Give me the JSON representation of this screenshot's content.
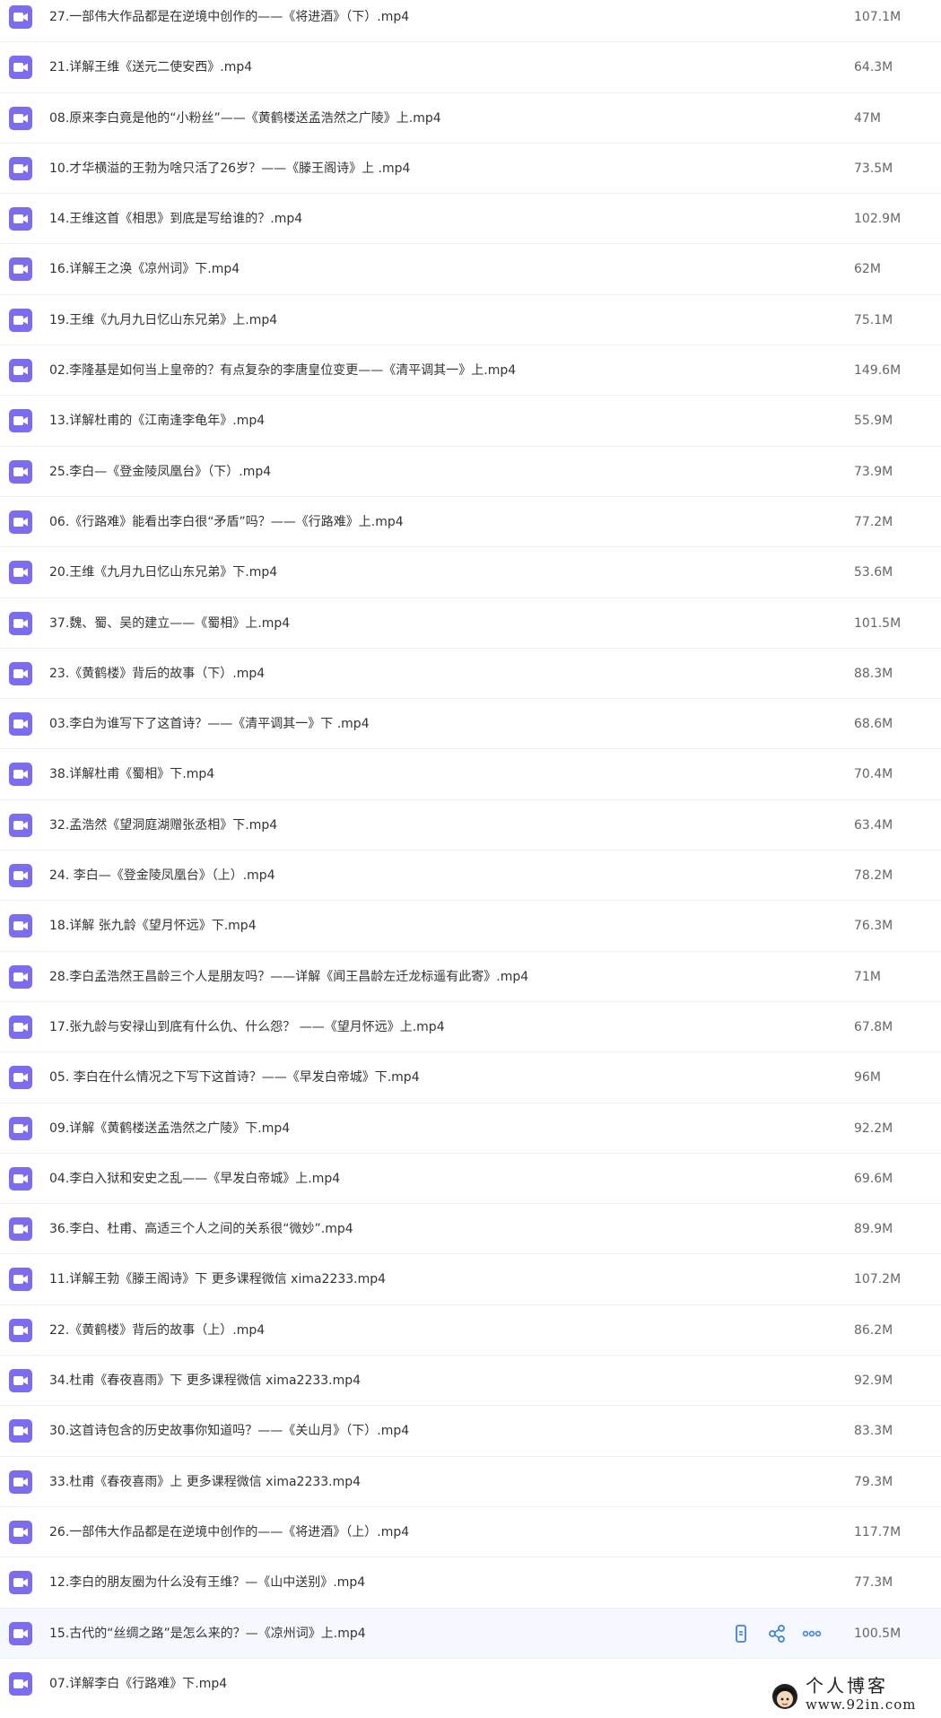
{
  "files": [
    {
      "name": "27.一部伟大作品都是在逆境中创作的——《将进酒》（下）.mp4",
      "size": "107.1M"
    },
    {
      "name": "21.详解王维《送元二使安西》.mp4",
      "size": "64.3M"
    },
    {
      "name": "08.原来李白竟是他的“小粉丝”——《黄鹤楼送孟浩然之广陵》上.mp4",
      "size": "47M"
    },
    {
      "name": "10.才华横溢的王勃为啥只活了26岁？——《滕王阁诗》上 .mp4",
      "size": "73.5M"
    },
    {
      "name": "14.王维这首《相思》到底是写给谁的？.mp4",
      "size": "102.9M"
    },
    {
      "name": "16.详解王之涣《凉州词》下.mp4",
      "size": "62M"
    },
    {
      "name": "19.王维《九月九日忆山东兄弟》上.mp4",
      "size": "75.1M"
    },
    {
      "name": "02.李隆基是如何当上皇帝的？有点复杂的李唐皇位变更——《清平调其一》上.mp4",
      "size": "149.6M"
    },
    {
      "name": "13.详解杜甫的《江南逢李龟年》.mp4",
      "size": "55.9M"
    },
    {
      "name": "25.李白—《登金陵凤凰台》（下）.mp4",
      "size": "73.9M"
    },
    {
      "name": "06.《行路难》能看出李白很“矛盾”吗？——《行路难》上.mp4",
      "size": "77.2M"
    },
    {
      "name": "20.王维《九月九日忆山东兄弟》下.mp4",
      "size": "53.6M"
    },
    {
      "name": "37.魏、蜀、吴的建立——《蜀相》上.mp4",
      "size": "101.5M"
    },
    {
      "name": "23.《黄鹤楼》背后的故事（下）.mp4",
      "size": "88.3M"
    },
    {
      "name": "03.李白为谁写下了这首诗？——《清平调其一》下 .mp4",
      "size": "68.6M"
    },
    {
      "name": "38.详解杜甫《蜀相》下.mp4",
      "size": "70.4M"
    },
    {
      "name": "32.孟浩然《望洞庭湖赠张丞相》下.mp4",
      "size": "63.4M"
    },
    {
      "name": "24. 李白—《登金陵凤凰台》（上）.mp4",
      "size": "78.2M"
    },
    {
      "name": "18.详解 张九龄《望月怀远》下.mp4",
      "size": "76.3M"
    },
    {
      "name": "28.李白孟浩然王昌龄三个人是朋友吗？——详解《闻王昌龄左迁龙标遥有此寄》.mp4",
      "size": "71M"
    },
    {
      "name": "17.张九龄与安禄山到底有什么仇、什么怨？ ——《望月怀远》上.mp4",
      "size": "67.8M"
    },
    {
      "name": "05. 李白在什么情况之下写下这首诗？——《早发白帝城》下.mp4",
      "size": "96M"
    },
    {
      "name": "09.详解《黄鹤楼送孟浩然之广陵》下.mp4",
      "size": "92.2M"
    },
    {
      "name": "04.李白入狱和安史之乱——《早发白帝城》上.mp4",
      "size": "69.6M"
    },
    {
      "name": "36.李白、杜甫、高适三个人之间的关系很“微妙”.mp4",
      "size": "89.9M"
    },
    {
      "name": "11.详解王勃《滕王阁诗》下 更多课程微信 xima2233.mp4",
      "size": "107.2M"
    },
    {
      "name": "22.《黄鹤楼》背后的故事（上）.mp4",
      "size": "86.2M"
    },
    {
      "name": "34.杜甫《春夜喜雨》下 更多课程微信 xima2233.mp4",
      "size": "92.9M"
    },
    {
      "name": "30.这首诗包含的历史故事你知道吗？——《关山月》（下）.mp4",
      "size": "83.3M"
    },
    {
      "name": "33.杜甫《春夜喜雨》上 更多课程微信 xima2233.mp4",
      "size": "79.3M"
    },
    {
      "name": "26.一部伟大作品都是在逆境中创作的——《将进酒》（上）.mp4",
      "size": "117.7M"
    },
    {
      "name": "12.李白的朋友圈为什么没有王维？—《山中送别》.mp4",
      "size": "77.3M"
    },
    {
      "name": "15.古代的“丝绸之路”是怎么来的？—《凉州词》上.mp4",
      "size": "100.5M",
      "hover": true
    },
    {
      "name": "07.详解李白《行路难》下.mp4",
      "size": ""
    }
  ],
  "watermark": {
    "name": "个人博客",
    "url": "www.92in.com"
  },
  "colors": {
    "file_icon": "#7c6cf3",
    "action_icon": "#3b82f6",
    "hover_row": "#f5f8ff"
  },
  "icons": {
    "file": "video-file-icon",
    "phone": "phone-icon",
    "share": "share-icon",
    "more": "more-icon"
  }
}
